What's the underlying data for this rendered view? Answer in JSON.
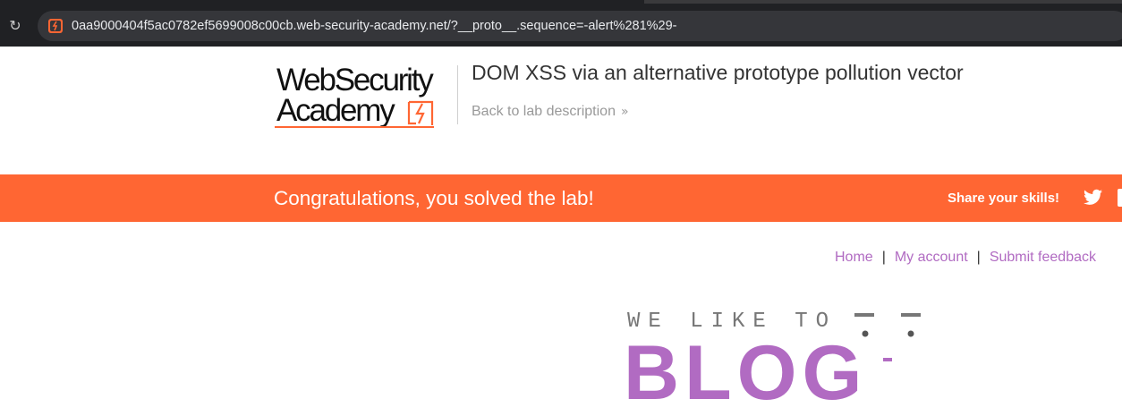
{
  "browser": {
    "url": "0aa9000404f5ac0782ef5699008c00cb.web-security-academy.net/?__proto__.sequence=-alert%281%29-",
    "reload_icon": "reload-icon",
    "favicon_icon": "lab-favicon-icon"
  },
  "header": {
    "logo_line1": "WebSecurity",
    "logo_line2": "Academy",
    "lab_title": "DOM XSS via an alternative prototype pollution vector",
    "back_link": "Back to lab description",
    "back_chevron": "»"
  },
  "banner": {
    "message": "Congratulations, you solved the lab!",
    "share_label": "Share your skills!",
    "color": "#ff6633"
  },
  "nav": {
    "home": "Home",
    "separator": "|",
    "my_account": "My account",
    "submit_feedback": "Submit feedback"
  },
  "hero": {
    "tagline": "WE LIKE TO",
    "word": "BLOG"
  },
  "colors": {
    "accent": "#ff6633",
    "link": "#b16bc2",
    "chrome": "#202124"
  }
}
